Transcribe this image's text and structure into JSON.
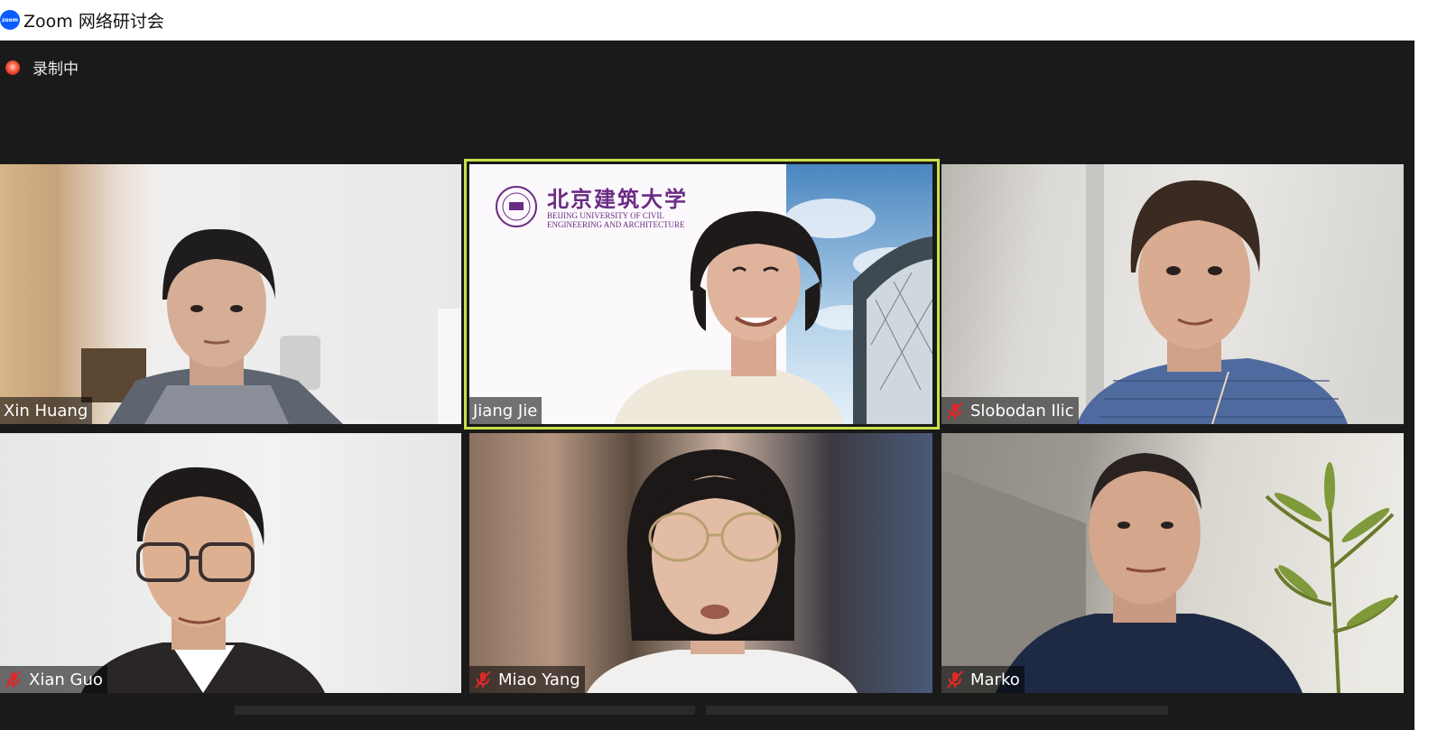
{
  "window": {
    "logo_text": "zoom",
    "title": "Zoom 网络研讨会"
  },
  "recording": {
    "label": "录制中"
  },
  "participants": [
    {
      "name": "Xin Huang",
      "muted": false,
      "active_speaker": false
    },
    {
      "name": "Jiang Jie",
      "muted": false,
      "active_speaker": true
    },
    {
      "name": "Slobodan Ilic",
      "muted": true,
      "active_speaker": false
    },
    {
      "name": "Xian Guo",
      "muted": true,
      "active_speaker": false
    },
    {
      "name": "Miao Yang",
      "muted": true,
      "active_speaker": false
    },
    {
      "name": "Marko",
      "muted": true,
      "active_speaker": false
    }
  ],
  "background_banner": {
    "cn": "北京建筑大学",
    "en_line1": "BEIJING UNIVERSITY OF CIVIL",
    "en_line2": "ENGINEERING AND ARCHITECTURE"
  },
  "colors": {
    "active_speaker_border": "#c8e14a",
    "mute_icon": "#e02828",
    "university_purple": "#6a2c83",
    "recording": "#e03a22"
  }
}
